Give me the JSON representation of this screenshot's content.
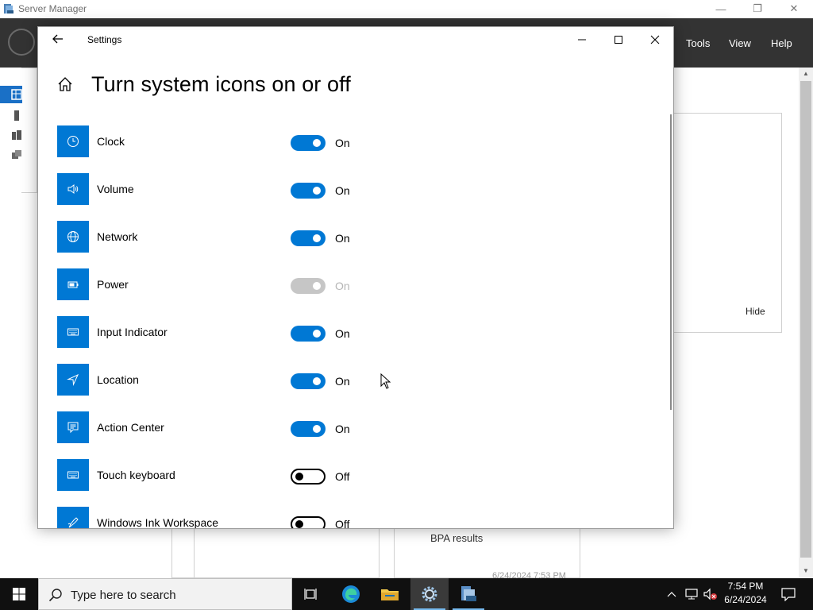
{
  "server_manager": {
    "title": "Server Manager",
    "menu": {
      "tools": "Tools",
      "view": "View",
      "help": "Help"
    },
    "panel_hide": "Hide",
    "bpa_results": "BPA results",
    "bpa_date": "6/24/2024 7:53 PM"
  },
  "settings": {
    "app_title": "Settings",
    "heading": "Turn system icons on or off",
    "items": [
      {
        "label": "Clock",
        "icon": "clock-icon",
        "state": "On",
        "enabled": true
      },
      {
        "label": "Volume",
        "icon": "volume-icon",
        "state": "On",
        "enabled": true
      },
      {
        "label": "Network",
        "icon": "network-icon",
        "state": "On",
        "enabled": true
      },
      {
        "label": "Power",
        "icon": "power-icon",
        "state": "On",
        "enabled": false
      },
      {
        "label": "Input Indicator",
        "icon": "keyboard-icon",
        "state": "On",
        "enabled": true
      },
      {
        "label": "Location",
        "icon": "location-icon",
        "state": "On",
        "enabled": true
      },
      {
        "label": "Action Center",
        "icon": "action-center-icon",
        "state": "On",
        "enabled": true
      },
      {
        "label": "Touch keyboard",
        "icon": "touch-keyboard-icon",
        "state": "Off",
        "enabled": true
      },
      {
        "label": "Windows Ink Workspace",
        "icon": "pen-icon",
        "state": "Off",
        "enabled": true
      }
    ]
  },
  "taskbar": {
    "search_placeholder": "Type here to search",
    "time": "7:54 PM",
    "date": "6/24/2024"
  },
  "colors": {
    "accent": "#0078d4",
    "taskbar": "#101010",
    "sm_header": "#333333"
  }
}
